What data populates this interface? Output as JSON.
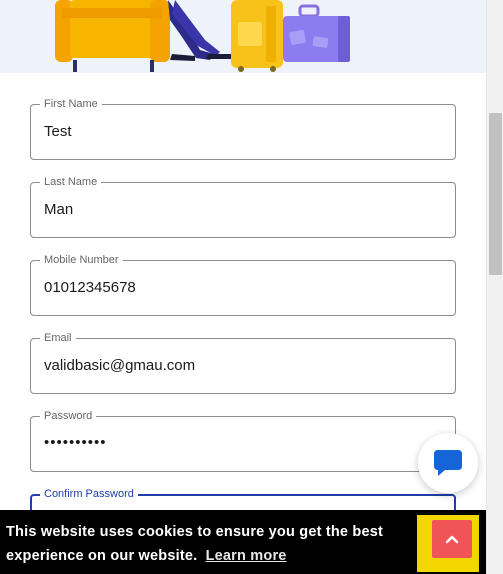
{
  "form": {
    "fields": [
      {
        "label": "First Name",
        "value": "Test"
      },
      {
        "label": "Last Name",
        "value": "Man"
      },
      {
        "label": "Mobile Number",
        "value": "01012345678"
      },
      {
        "label": "Email",
        "value": "validbasic@gmau.com"
      },
      {
        "label": "Password",
        "value": "••••••••••"
      },
      {
        "label": "Confirm Password",
        "value": ""
      }
    ]
  },
  "cookie_bar": {
    "message": "This website uses cookies to ensure you get the best experience on our website.",
    "learn_more": "Learn more"
  },
  "icons": {
    "chat": "chat-bubble-icon",
    "scroll_top": "chevron-up-icon"
  },
  "colors": {
    "accent_blue": "#1c3faa",
    "chat_blue": "#1565d8",
    "cookie_button": "#f2d600",
    "scroll_top_button": "#f05456"
  }
}
